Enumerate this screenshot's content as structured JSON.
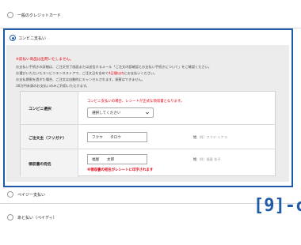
{
  "options": {
    "credit_card": "一般のクレジットカード",
    "convenience": "コンビニ支払い",
    "paypay": "ペイジー支払い",
    "atobarai": "あと払い（ペイディ）"
  },
  "panel": {
    "warning": "※前払い商品は出荷いたしません。",
    "notes": [
      "お支払い手続きの詳細は、ご注文完了画面または送信するメール「ご注文内容確認とお支払い手続きについて」をご確認ください。",
      "お選びいただいたコンビニエンスストアで、ご注文日を含めて",
      "お支払期限を過ぎた場合、ご注文は自動的にキャンセルされます。振替はできません。",
      "30万円未満のお支払いのみご利用いただけます。"
    ],
    "deadline_em": "4日間以内",
    "deadline_tail": "にお支払いください。"
  },
  "form": {
    "store": {
      "label": "コンビニ選択",
      "note": "コンビニ支払いの場合、レシートが正式な領収書となります。",
      "select_value": "選択してください"
    },
    "name_kana": {
      "label": "ご注文主（フリガナ）",
      "sei": "フクヤ",
      "mei": "タロウ",
      "sep": "姓",
      "example": "例）フクヤ ハナコ"
    },
    "receipt_name": {
      "label": "領収書の宛名",
      "sei": "福屋",
      "mei": "太郎",
      "sep": "姓",
      "example": "例）福屋 花子",
      "warning": "※領収書の宛名がレシートに印字されます"
    }
  },
  "badge": "[9]-c",
  "colors": {
    "accent": "#1f5ba8",
    "alert": "#e60012"
  },
  "icons": {
    "select": "chevron-down-icon"
  }
}
